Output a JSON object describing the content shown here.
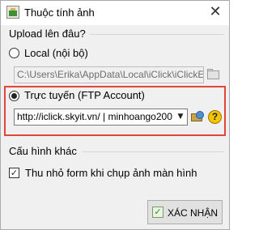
{
  "window": {
    "title": "Thuộc tính ảnh",
    "close_glyph": "✕"
  },
  "upload": {
    "section_title": "Upload lên đâu?",
    "local": {
      "label": "Local (nội bộ)",
      "checked": false,
      "path_value": "C:\\Users\\Erika\\AppData\\Local\\iClick\\iClickEc"
    },
    "ftp": {
      "label": "Trực tuyến (FTP Account)",
      "checked": true,
      "combo_value": "http://iclick.skyit.vn/ | minhoango200",
      "arrow_glyph": "▼",
      "help_glyph": "?"
    },
    "highlight_color": "#e0463a"
  },
  "other": {
    "section_title": "Cấu hình khác",
    "minimize_label": "Thu nhỏ form khi chụp ảnh màn hình",
    "minimize_checked": true,
    "check_glyph": "✓"
  },
  "footer": {
    "confirm_label": "XÁC NHẬN",
    "confirm_icon_glyph": "✓"
  }
}
